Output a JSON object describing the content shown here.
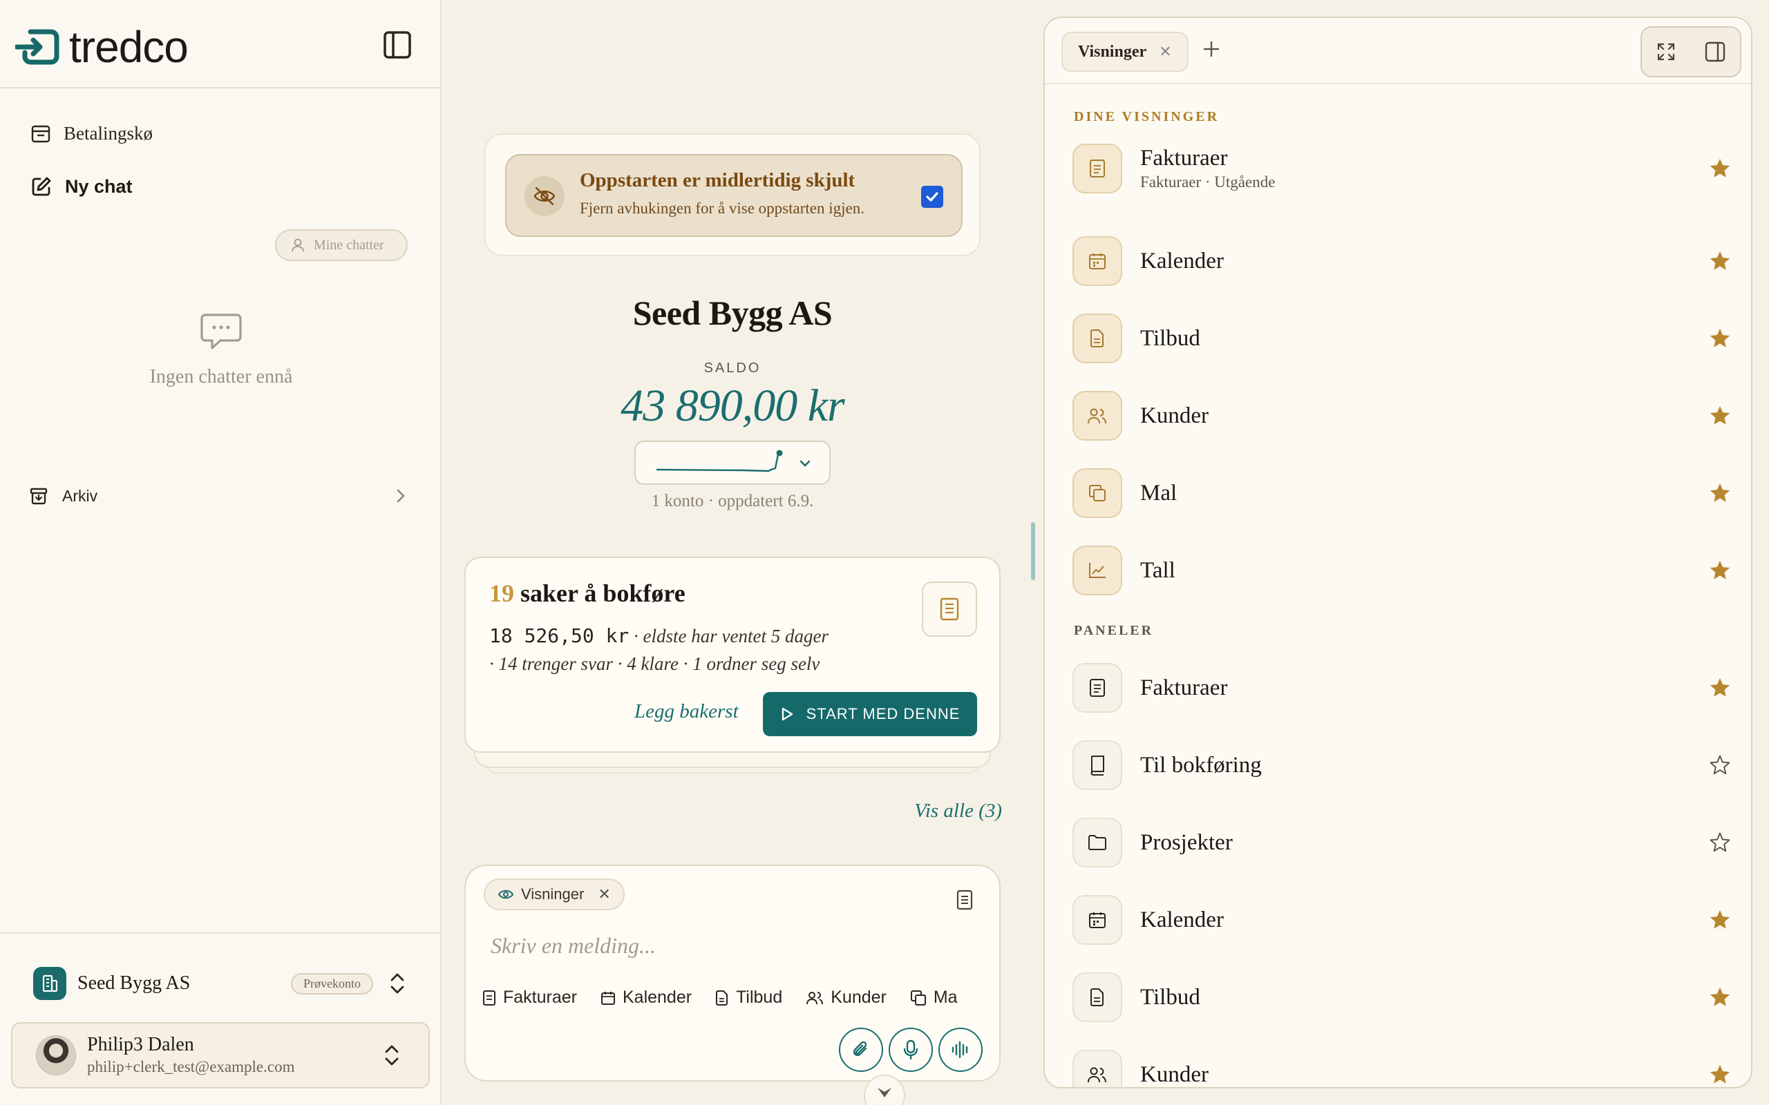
{
  "brand": {
    "name": "tredco",
    "accent": "#156a69",
    "gold": "#b8862e"
  },
  "sidebar": {
    "toggle_icon": "sidebar-toggle-icon",
    "nav": [
      {
        "label": "Betalingskø",
        "icon": "inbox-icon"
      },
      {
        "label": "Ny chat",
        "icon": "edit-icon"
      }
    ],
    "mine_chatter": "Mine chatter",
    "empty_chats": "Ingen chatter ennå",
    "archive": "Arkiv",
    "org": {
      "name": "Seed Bygg AS",
      "badge": "Prøvekonto"
    },
    "user": {
      "name": "Philip3 Dalen",
      "email": "philip+clerk_test@example.com"
    }
  },
  "notice": {
    "title": "Oppstarten er midlertidig skjult",
    "subtitle": "Fjern avhukingen for å vise oppstarten igjen.",
    "checked": true
  },
  "company": {
    "name": "Seed Bygg AS",
    "saldo_label": "SALDO",
    "saldo": "43 890,00 kr",
    "account_info": "1 konto · oppdatert 6.9."
  },
  "task": {
    "count": "19",
    "title_rest": " saker å bokføre",
    "amount": "18 526,50 kr",
    "amount_note": " · eldste har ventet 5 dager",
    "meta": "· 14 trenger svar · 4 klare · 1 ordner seg selv",
    "later": "Legg bakerst",
    "start": "START MED DENNE"
  },
  "see_all": "Vis alle (3)",
  "composer": {
    "chip": "Visninger",
    "placeholder": "Skriv en melding...",
    "quick": [
      "Fakturaer",
      "Kalender",
      "Tilbud",
      "Kunder",
      "Ma"
    ]
  },
  "panel": {
    "tab": "Visninger",
    "section_views": "DINE VISNINGER",
    "section_panels": "PANELER",
    "views": [
      {
        "title": "Fakturaer",
        "subtitle": "Fakturaer · Utgående",
        "icon": "document-icon",
        "starred": true
      },
      {
        "title": "Kalender",
        "subtitle": "",
        "icon": "calendar-icon",
        "starred": true
      },
      {
        "title": "Tilbud",
        "subtitle": "",
        "icon": "file-icon",
        "starred": true
      },
      {
        "title": "Kunder",
        "subtitle": "",
        "icon": "users-icon",
        "starred": true
      },
      {
        "title": "Mal",
        "subtitle": "",
        "icon": "copy-icon",
        "starred": true
      },
      {
        "title": "Tall",
        "subtitle": "",
        "icon": "chart-icon",
        "starred": true
      }
    ],
    "panels": [
      {
        "title": "Fakturaer",
        "icon": "document-icon",
        "starred": true
      },
      {
        "title": "Til bokføring",
        "icon": "book-icon",
        "starred": false
      },
      {
        "title": "Prosjekter",
        "icon": "folder-icon",
        "starred": false
      },
      {
        "title": "Kalender",
        "icon": "calendar-icon",
        "starred": true
      },
      {
        "title": "Tilbud",
        "icon": "file-icon",
        "starred": true
      },
      {
        "title": "Kunder",
        "icon": "users-icon",
        "starred": true
      }
    ]
  }
}
